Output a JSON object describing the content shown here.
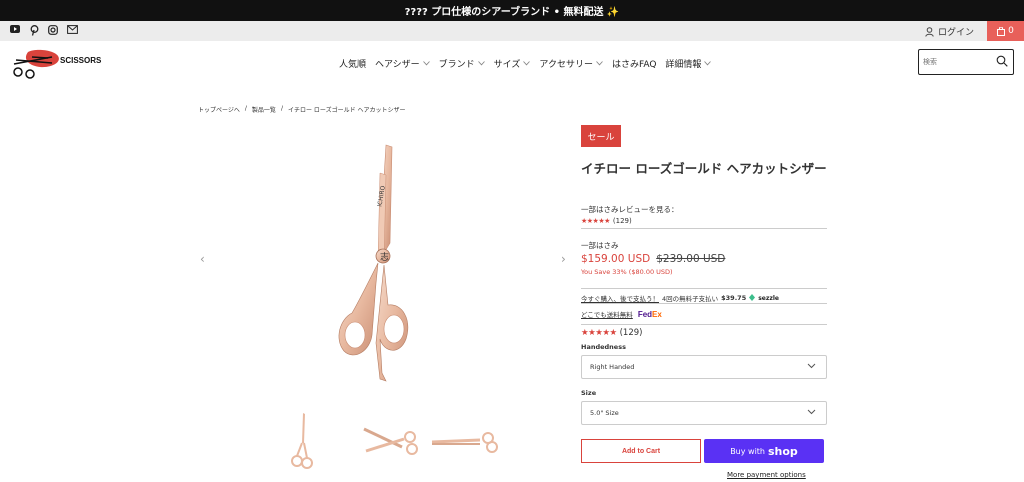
{
  "announcement": {
    "text": "???? プロ仕様のシアーブランド • 無料配送 ✨"
  },
  "topbar": {
    "social_icons": [
      "youtube-icon",
      "pinterest-icon",
      "instagram-icon",
      "mail-icon"
    ],
    "login_label": "ログイン",
    "cart_count": "0"
  },
  "header": {
    "logo_text": "SCISSORS",
    "nav": [
      {
        "label": "人気順",
        "has_dropdown": false
      },
      {
        "label": "ヘアシザー",
        "has_dropdown": true
      },
      {
        "label": "ブランド",
        "has_dropdown": true
      },
      {
        "label": "サイズ",
        "has_dropdown": true
      },
      {
        "label": "アクセサリー",
        "has_dropdown": true
      },
      {
        "label": "はさみFAQ",
        "has_dropdown": false
      },
      {
        "label": "詳細情報",
        "has_dropdown": true
      }
    ],
    "search_placeholder": "検索"
  },
  "breadcrumb": [
    "トップページへ",
    "/",
    "製品一覧",
    "/",
    "イチロー ローズゴールド ヘアカットシザー"
  ],
  "product": {
    "sale_badge": "セール",
    "title": "イチロー ローズゴールド ヘアカットシザー",
    "review_heading": "一部はさみレビューを見る：",
    "stars": "★★★★★",
    "review_count": "(129)",
    "vendor": "一部はさみ",
    "price": "$159.00 USD",
    "compare_price": "$239.00 USD",
    "savings": "You Save 33% ($80.00 USD)",
    "sezzle_link": "今すぐ購入、後で支払う！",
    "sezzle_text": "4回の無料子支払い",
    "sezzle_amount": "$39.75",
    "sezzle_brand": "sezzle",
    "shipping_link": "どこでも送料無料",
    "shipping_brand": "FedEx",
    "handedness_label": "Handedness",
    "handedness_value": "Right Handed",
    "size_label": "Size",
    "size_value": "5.0\" Size",
    "add_to_cart": "Add to Cart",
    "buy_with": "Buy with",
    "buy_brand": "shop",
    "more_payment": "More payment options"
  },
  "colors": {
    "accent": "#d9433c",
    "rose_gold": "#e8b9a0",
    "shop_pay": "#5a31f4",
    "cart": "#e8605a"
  }
}
